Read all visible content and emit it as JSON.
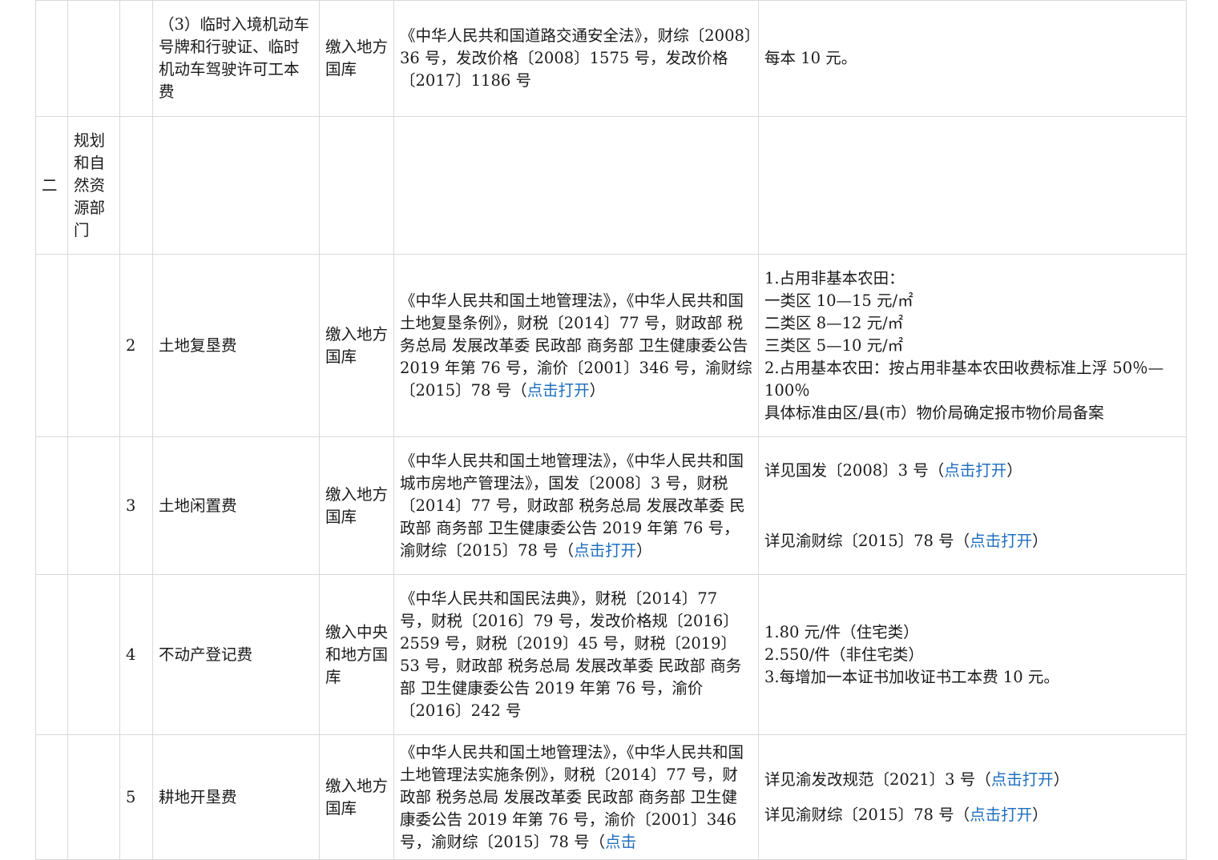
{
  "rows": {
    "r1": {
      "item": "（3）临时入境机动车号牌和行驶证、临时机动车驾驶许可工本费",
      "treasury": "缴入地方国库",
      "basis": "《中华人民共和国道路交通安全法》，财综〔2008〕36 号，发改价格〔2008〕1575 号，发改价格〔2017〕1186 号",
      "standard": "每本  10  元。"
    },
    "r2": {
      "index": "二",
      "department": "规划和自然资源部门"
    },
    "r3": {
      "no": "2",
      "item": "土地复垦费",
      "treasury": "缴入地方国库",
      "basis": "《中华人民共和国土地管理法》，《中华人民共和国土地复垦条例》，财税〔2014〕77 号，财政部  税务总局  发展改革委  民政部  商务部  卫生健康委公告 2019 年第 76 号，渝价〔2001〕346 号，渝财综〔2015〕78 号（",
      "basis_link": "点击打开",
      "basis_tail": "）",
      "standard_lines": [
        "1.占用非基本农田：",
        "一类区 10—15 元/㎡",
        "二类区 8—12 元/㎡",
        "三类区 5—10 元/㎡",
        "2.占用基本农田：按占用非基本农田收费标准上浮 50％—100％",
        "具体标准由区/县(市）物价局确定报市物价局备案"
      ]
    },
    "r4": {
      "no": "3",
      "item": "土地闲置费",
      "treasury": "缴入地方国库",
      "basis": "《中华人民共和国土地管理法》，《中华人民共和国城市房地产管理法》，国发〔2008〕3 号，财税〔2014〕77 号，财政部  税务总局  发展改革委  民政部  商务部  卫生健康委公告 2019 年第 76 号，渝财综〔2015〕78 号（",
      "basis_link": "点击打开",
      "basis_tail": "）",
      "standard_a": "详见国发〔2008〕3 号（",
      "standard_a_link": "点击打开",
      "standard_a_tail": "）",
      "standard_b": "详见渝财综〔2015〕78 号（",
      "standard_b_link": "点击打开",
      "standard_b_tail": "）"
    },
    "r5": {
      "no": "4",
      "item": "不动产登记费",
      "treasury": "缴入中央和地方国库",
      "basis": "《中华人民共和国民法典》，财税〔2014〕77 号，财税〔2016〕79 号，发改价格规〔2016〕2559 号，财税〔2019〕45 号，财税〔2019〕53 号，财政部  税务总局  发展改革委  民政部  商务部  卫生健康委公告 2019 年第 76 号，渝价〔2016〕242 号",
      "standard_lines": [
        "1.80 元/件（住宅类）",
        "2.550/件（非住宅类）",
        "3.每增加一本证书加收证书工本费 10 元。"
      ]
    },
    "r6": {
      "no": "5",
      "item": "耕地开垦费",
      "treasury": "缴入地方国库",
      "basis": "《中华人民共和国土地管理法》，《中华人民共和国土地管理法实施条例》，财税〔2014〕77 号，财政部  税务总局  发展改革委  民政部  商务部  卫生健康委公告 2019 年第 76 号，渝价〔2001〕346 号，渝财综〔2015〕78 号（",
      "basis_link": "点击",
      "standard_a": "详见渝发改规范〔2021〕3 号（",
      "standard_a_link": "点击打开",
      "standard_a_tail": "）",
      "standard_b": "详见渝财综〔2015〕78 号（",
      "standard_b_link": "点击打开",
      "standard_b_tail": "）"
    }
  }
}
